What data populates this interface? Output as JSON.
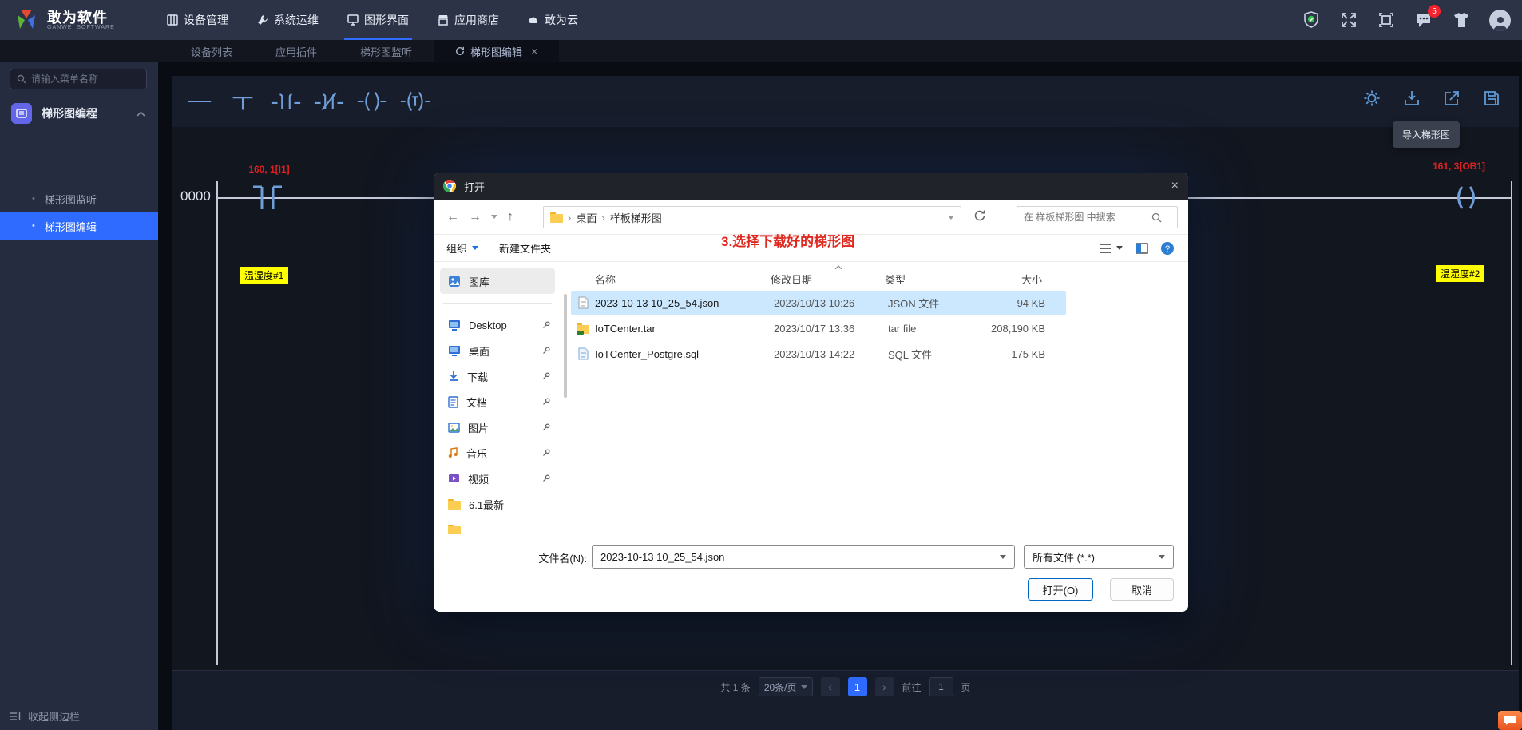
{
  "topbar": {
    "logo_title": "敢为软件",
    "logo_subtitle": "GANWEI SOFTWARE",
    "nav": [
      {
        "label": "设备管理"
      },
      {
        "label": "系统运维"
      },
      {
        "label": "图形界面"
      },
      {
        "label": "应用商店"
      },
      {
        "label": "敢为云"
      }
    ],
    "message_badge": "5"
  },
  "tabs": [
    {
      "label": "设备列表"
    },
    {
      "label": "应用插件"
    },
    {
      "label": "梯形图监听"
    },
    {
      "label": "梯形图编辑"
    }
  ],
  "sidebar": {
    "search_placeholder": "请输入菜单名称",
    "group_label": "梯形图编程",
    "items": [
      {
        "label": "梯形图监听"
      },
      {
        "label": "梯形图编辑"
      }
    ],
    "collapse_label": "收起侧边栏"
  },
  "editor": {
    "rung_number": "0000",
    "contact_address": "160, 1[I1]",
    "contact_tag": "温湿度#1",
    "coil_address": "161, 3[OB1]",
    "coil_tag": "温湿度#2",
    "import_tooltip": "导入梯形图"
  },
  "annotation": "3.选择下载好的梯形图",
  "dialog": {
    "title": "打开",
    "breadcrumb": {
      "root": "桌面",
      "folder": "样板梯形图"
    },
    "search_placeholder": "在 样板梯形图 中搜索",
    "organize_label": "组织",
    "new_folder_label": "新建文件夹",
    "sidebar": [
      {
        "label": "图库"
      },
      {
        "label": "Desktop"
      },
      {
        "label": "桌面"
      },
      {
        "label": "下载"
      },
      {
        "label": "文档"
      },
      {
        "label": "图片"
      },
      {
        "label": "音乐"
      },
      {
        "label": "视频"
      },
      {
        "label": "6.1最新"
      }
    ],
    "columns": {
      "name": "名称",
      "date": "修改日期",
      "type": "类型",
      "size": "大小"
    },
    "files": [
      {
        "name": "2023-10-13 10_25_54.json",
        "date": "2023/10/13 10:26",
        "type": "JSON 文件",
        "size": "94 KB"
      },
      {
        "name": "IoTCenter.tar",
        "date": "2023/10/17 13:36",
        "type": "tar file",
        "size": "208,190 KB"
      },
      {
        "name": "IoTCenter_Postgre.sql",
        "date": "2023/10/13 14:22",
        "type": "SQL 文件",
        "size": "175 KB"
      }
    ],
    "filename_label": "文件名(N):",
    "filename_value": "2023-10-13 10_25_54.json",
    "filetype_value": "所有文件 (*.*)",
    "open_label": "打开(O)",
    "cancel_label": "取消"
  },
  "pagination": {
    "total": "共 1 条",
    "page_size": "20条/页",
    "prev": "‹",
    "next": "›",
    "page": "1",
    "goto_prefix": "前往",
    "goto_value": "1",
    "goto_suffix": "页"
  },
  "colors": {
    "accent": "#2f6bff",
    "selection": "#cce8ff",
    "annotation_red": "#e0281e",
    "tag_yellow": "#ffff00",
    "ladder_blue": "#6f9ed9"
  }
}
